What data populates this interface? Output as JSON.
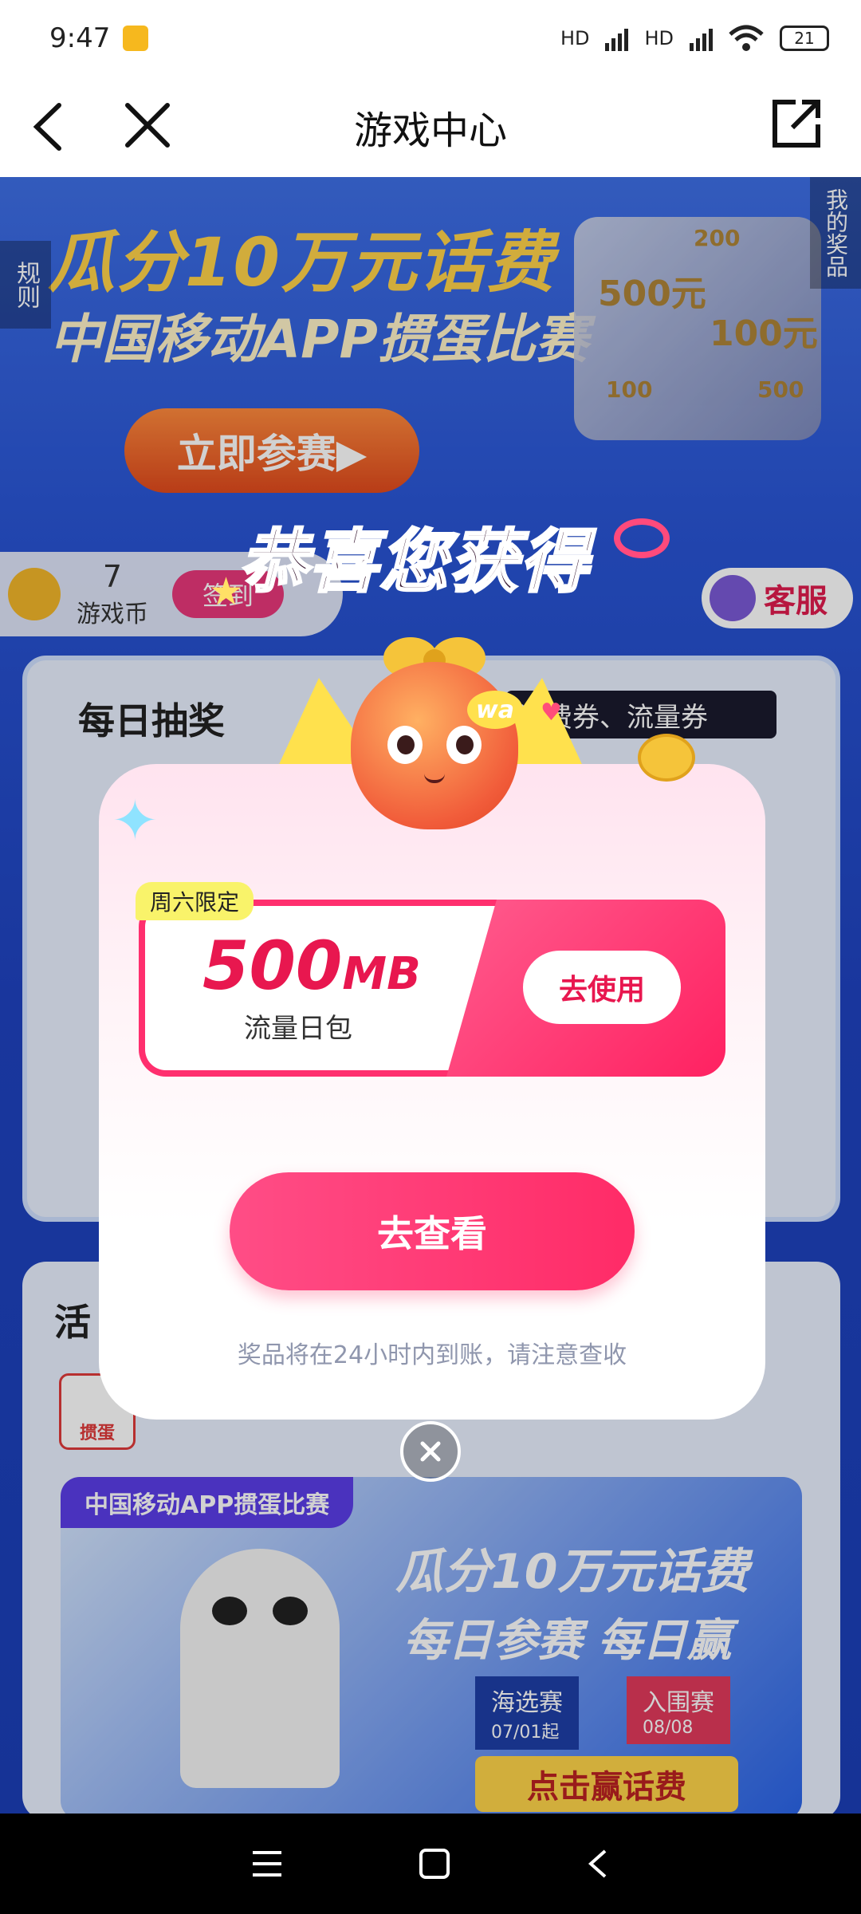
{
  "status_bar": {
    "time": "9:47",
    "network_1": "HD",
    "network_2": "HD",
    "battery": "21"
  },
  "nav": {
    "title": "游戏中心"
  },
  "background": {
    "banner_title": "瓜分10万元话费",
    "banner_subtitle": "中国移动APP掼蛋比赛",
    "join_button": "立即参赛▶",
    "rules_tab": "规则",
    "my_prizes_tab": "我的奖品",
    "gift_notes": [
      "500元",
      "100元",
      "200",
      "100",
      "500"
    ],
    "coin_count": "7",
    "coin_label": "游戏币",
    "checkin_button": "签到",
    "service_button": "客服",
    "daily_draw_title": "每日抽奖",
    "daily_draw_note": "话费券、流量券",
    "activities_title": "活",
    "game_tile_label": "掼蛋",
    "promo": {
      "tag": "中国移动APP掼蛋比赛",
      "line1": "瓜分10万元话费",
      "line2": "每日参赛 每日赢",
      "round1_name": "海选赛",
      "round1_date": "07/01起",
      "round2_name": "入围赛",
      "round2_date": "08/08",
      "cta": "点击赢话费"
    }
  },
  "popup": {
    "headline": "恭喜您获得",
    "mascot_bubble": "wa",
    "coupon": {
      "tag": "周六限定",
      "amount": "500",
      "unit": "MB",
      "description": "流量日包",
      "use_button": "去使用"
    },
    "view_button": "去查看",
    "notice": "奖品将在24小时内到账，请注意查收"
  },
  "colors": {
    "accent_pink": "#ff2b67",
    "coupon_text": "#e8174f",
    "background_blue": "#1f43c0"
  }
}
